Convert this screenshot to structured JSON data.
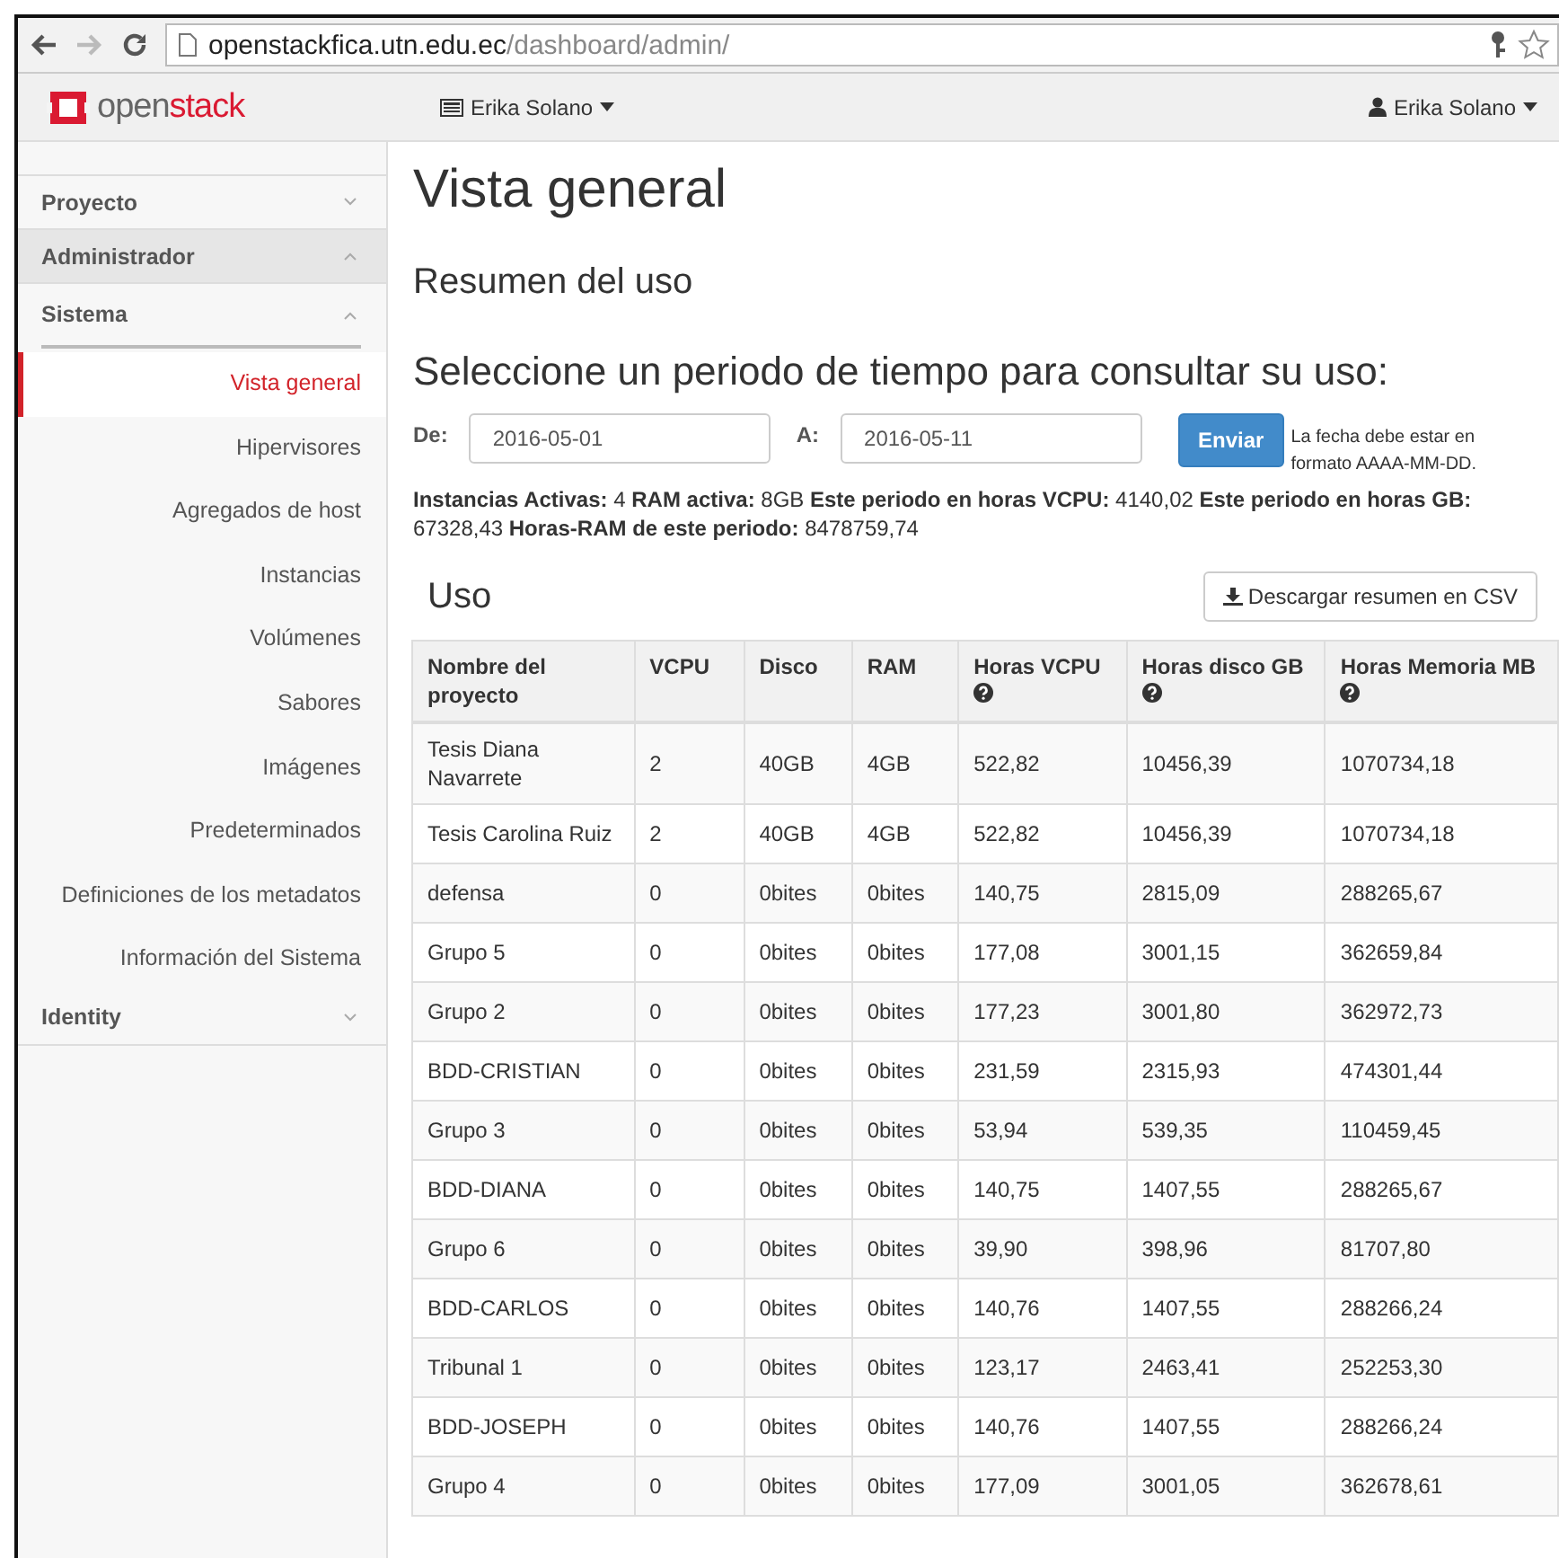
{
  "browser": {
    "url": {
      "host": "openstackfica.utn.edu.ec",
      "path": "/dashboard/admin/"
    }
  },
  "topbar": {
    "brand": [
      "open",
      "stack"
    ],
    "project_menu": "Erika Solano",
    "user_menu": "Erika Solano"
  },
  "sidebar": {
    "sections": [
      {
        "label": "Proyecto",
        "expanded": false
      },
      {
        "label": "Administrador",
        "expanded": true,
        "panels": [
          {
            "label": "Sistema",
            "expanded": true,
            "items": [
              {
                "label": "Vista general",
                "selected": true
              },
              {
                "label": "Hipervisores",
                "selected": false
              },
              {
                "label": "Agregados de host",
                "selected": false
              },
              {
                "label": "Instancias",
                "selected": false
              },
              {
                "label": "Volúmenes",
                "selected": false
              },
              {
                "label": "Sabores",
                "selected": false
              },
              {
                "label": "Imágenes",
                "selected": false
              },
              {
                "label": "Predeterminados",
                "selected": false
              },
              {
                "label": "Definiciones de los metadatos",
                "selected": false
              },
              {
                "label": "Información del Sistema",
                "selected": false
              }
            ]
          }
        ]
      },
      {
        "label": "Identity",
        "expanded": false
      }
    ]
  },
  "page": {
    "title": "Vista general",
    "subtitle": "Resumen del uso",
    "period_heading": "Seleccione un periodo de tiempo para consultar su uso:",
    "form": {
      "from_label": "De:",
      "from_value": "2016-05-01",
      "to_label": "A:",
      "to_value": "2016-05-11",
      "submit": "Enviar",
      "hint": "La fecha debe estar en formato AAAA-MM-DD."
    },
    "summary": "**Instancias Activas:** 4 **RAM activa:** 8GB **Este periodo en horas VCPU:** 4140,02 **Este periodo en horas GB:** 67328,43 **Horas-RAM de este periodo:** 8478759,74",
    "usage_heading": "Uso",
    "download_button": "Descargar resumen en CSV"
  },
  "table": {
    "columns": [
      {
        "label": "Nombre del proyecto",
        "help": false
      },
      {
        "label": "VCPU",
        "help": false
      },
      {
        "label": "Disco",
        "help": false
      },
      {
        "label": "RAM",
        "help": false
      },
      {
        "label": "Horas VCPU",
        "help": true
      },
      {
        "label": "Horas disco GB",
        "help": true
      },
      {
        "label": "Horas Memoria MB",
        "help": true
      }
    ],
    "rows": [
      [
        "Tesis Diana Navarrete",
        "2",
        "40GB",
        "4GB",
        "522,82",
        "10456,39",
        "1070734,18"
      ],
      [
        "Tesis Carolina Ruiz",
        "2",
        "40GB",
        "4GB",
        "522,82",
        "10456,39",
        "1070734,18"
      ],
      [
        "defensa",
        "0",
        "0bites",
        "0bites",
        "140,75",
        "2815,09",
        "288265,67"
      ],
      [
        "Grupo 5",
        "0",
        "0bites",
        "0bites",
        "177,08",
        "3001,15",
        "362659,84"
      ],
      [
        "Grupo 2",
        "0",
        "0bites",
        "0bites",
        "177,23",
        "3001,80",
        "362972,73"
      ],
      [
        "BDD-CRISTIAN",
        "0",
        "0bites",
        "0bites",
        "231,59",
        "2315,93",
        "474301,44"
      ],
      [
        "Grupo 3",
        "0",
        "0bites",
        "0bites",
        "53,94",
        "539,35",
        "110459,45"
      ],
      [
        "BDD-DIANA",
        "0",
        "0bites",
        "0bites",
        "140,75",
        "1407,55",
        "288265,67"
      ],
      [
        "Grupo 6",
        "0",
        "0bites",
        "0bites",
        "39,90",
        "398,96",
        "81707,80"
      ],
      [
        "BDD-CARLOS",
        "0",
        "0bites",
        "0bites",
        "140,76",
        "1407,55",
        "288266,24"
      ],
      [
        "Tribunal 1",
        "0",
        "0bites",
        "0bites",
        "123,17",
        "2463,41",
        "252253,30"
      ],
      [
        "BDD-JOSEPH",
        "0",
        "0bites",
        "0bites",
        "140,76",
        "1407,55",
        "288266,24"
      ],
      [
        "Grupo 4",
        "0",
        "0bites",
        "0bites",
        "177,09",
        "3001,05",
        "362678,61"
      ]
    ]
  }
}
